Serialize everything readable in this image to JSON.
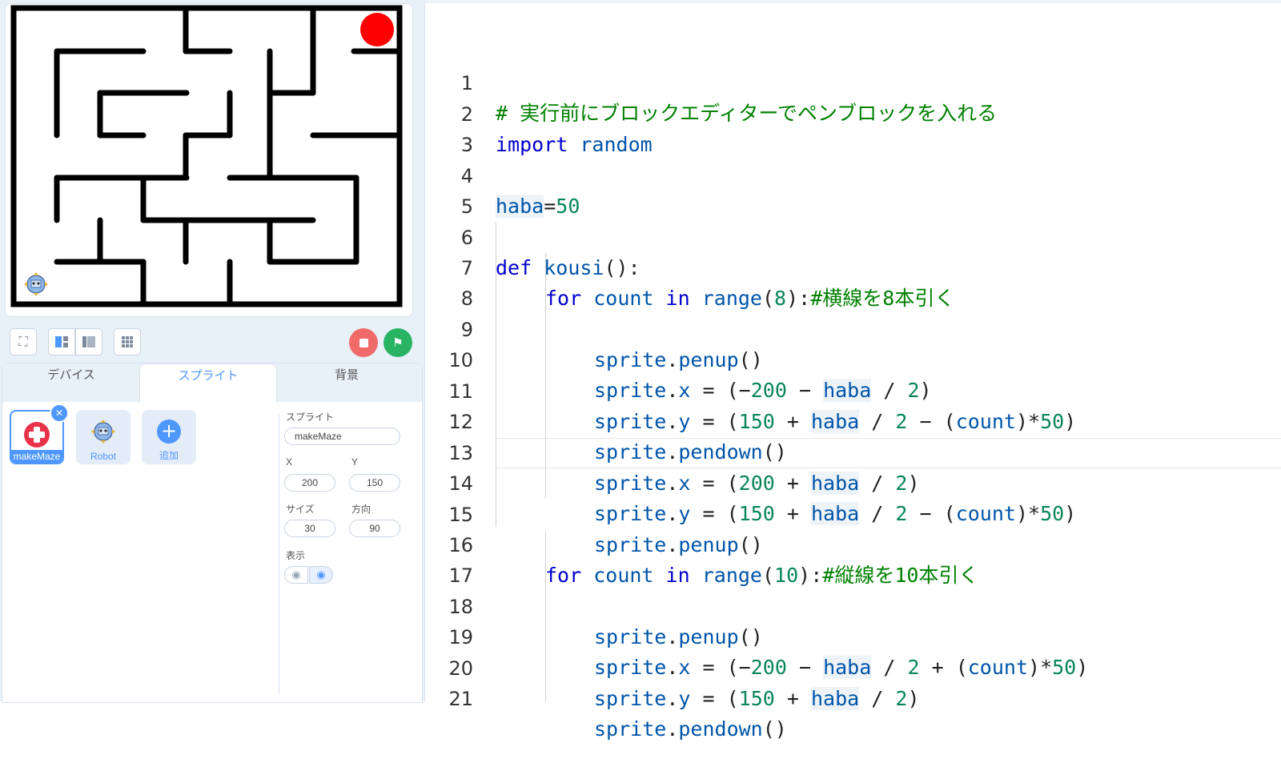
{
  "stage": {
    "sprite_icon": "robot-icon",
    "goal_color": "#ff0000"
  },
  "toolbar": {
    "fullscreen_icon": "fullscreen-icon",
    "layout_small_icon": "small-stage-icon",
    "layout_large_icon": "large-stage-icon",
    "grid_icon": "grid-icon",
    "stop_icon": "stop-icon",
    "go_icon": "green-flag-icon"
  },
  "tabs": [
    {
      "label": "デバイス"
    },
    {
      "label": "スプライト"
    },
    {
      "label": "背景"
    }
  ],
  "sprites": [
    {
      "label": "makeMaze"
    },
    {
      "label": "Robot"
    },
    {
      "label": "追加"
    }
  ],
  "props": {
    "sprite_label": "スプライト",
    "sprite_value": "makeMaze",
    "x_label": "X",
    "x_value": "200",
    "y_label": "Y",
    "y_value": "150",
    "size_label": "サイズ",
    "size_value": "30",
    "dir_label": "方向",
    "dir_value": "90",
    "show_label": "表示"
  },
  "code": {
    "line_numbers": [
      "1",
      "2",
      "3",
      "4",
      "5",
      "6",
      "7",
      "8",
      "9",
      "10",
      "11",
      "12",
      "13",
      "14",
      "15",
      "16",
      "17",
      "18",
      "19",
      "20",
      "21"
    ],
    "current_line": "14",
    "l1": "# 実行前にブロックエディターでペンブロックを入れる",
    "l2_kw": "import",
    "l2_nm": "random",
    "l4_nm": "haba",
    "l4_op": "=",
    "l4_num": "50",
    "l6_kw": "def",
    "l6_nm": "kousi",
    "l6_op": "():",
    "for_kw": "for",
    "count": "count",
    "in_kw": "in",
    "range": "range",
    "l7_num": "8",
    "l7_cm": "#横線を8本引く",
    "l16_num": "10",
    "l16_cm": "#縦線を10本引く",
    "sprite": "sprite",
    "penup": "penup",
    "pendown": "pendown",
    "x": "x",
    "y": "y",
    "haba": "haba",
    "n200": "200",
    "n150": "150",
    "n2": "2",
    "n50": "50"
  }
}
